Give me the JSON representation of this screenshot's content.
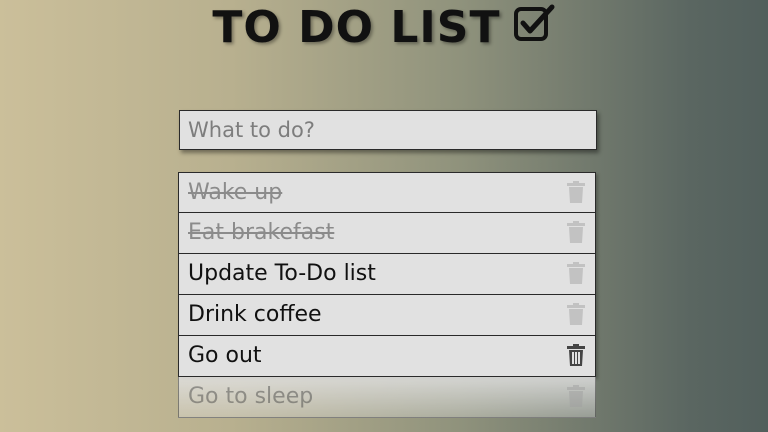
{
  "header": {
    "title": "TO DO LIST",
    "title_icon": "checkbox-checked-icon"
  },
  "new_todo": {
    "placeholder": "What to do?",
    "value": ""
  },
  "todos": [
    {
      "text": "Wake up",
      "completed": true,
      "delete_icon": "trash-icon"
    },
    {
      "text": "Eat brakefast",
      "completed": true,
      "delete_icon": "trash-icon"
    },
    {
      "text": "Update To-Do list",
      "completed": false,
      "delete_icon": "trash-icon"
    },
    {
      "text": "Drink coffee",
      "completed": false,
      "delete_icon": "trash-icon"
    },
    {
      "text": "Go out",
      "completed": false,
      "delete_icon": "trash-icon"
    },
    {
      "text": "Go to sleep",
      "completed": false,
      "delete_icon": "trash-icon"
    }
  ],
  "colors": {
    "item_background": "#e1e1e1",
    "completed_text": "#8b8b8b",
    "text": "#111111"
  }
}
